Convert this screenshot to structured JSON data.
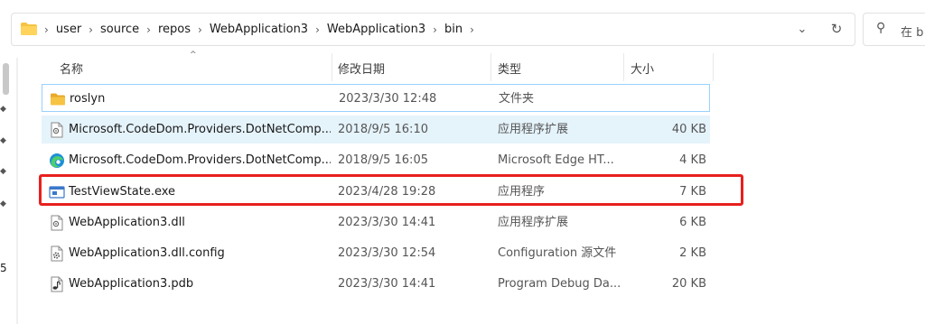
{
  "address": {
    "crumbs": [
      "user",
      "source",
      "repos",
      "WebApplication3",
      "WebApplication3",
      "bin"
    ],
    "separator": "›",
    "dropdown_glyph": "⌄",
    "refresh_glyph": "↻"
  },
  "search": {
    "placeholder": "在 b",
    "icon_glyph": "⚲"
  },
  "left_strip": {
    "number": "5"
  },
  "columns": {
    "name": "名称",
    "date": "修改日期",
    "type": "类型",
    "size": "大小"
  },
  "files": [
    {
      "name": "roslyn",
      "date": "2023/3/30 12:48",
      "type": "文件夹",
      "size": "",
      "icon": "folder-icon"
    },
    {
      "name": "Microsoft.CodeDom.Providers.DotNetComp...",
      "date": "2018/9/5 16:10",
      "type": "应用程序扩展",
      "size": "40 KB",
      "icon": "dll-icon"
    },
    {
      "name": "Microsoft.CodeDom.Providers.DotNetComp...",
      "date": "2018/9/5 16:05",
      "type": "Microsoft Edge HT...",
      "size": "4 KB",
      "icon": "edge-icon"
    },
    {
      "name": "TestViewState.exe",
      "date": "2023/4/28 19:28",
      "type": "应用程序",
      "size": "7 KB",
      "icon": "exe-icon"
    },
    {
      "name": "WebApplication3.dll",
      "date": "2023/3/30 14:41",
      "type": "应用程序扩展",
      "size": "6 KB",
      "icon": "dll-icon"
    },
    {
      "name": "WebApplication3.dll.config",
      "date": "2023/3/30 12:54",
      "type": "Configuration 源文件",
      "size": "2 KB",
      "icon": "config-icon"
    },
    {
      "name": "WebApplication3.pdb",
      "date": "2023/3/30 14:41",
      "type": "Program Debug Da...",
      "size": "20 KB",
      "icon": "pdb-icon"
    }
  ],
  "colors": {
    "selected_row": "#e5f3fb",
    "hover_border": "#99d1ff",
    "highlight_box": "#e8201d",
    "folder": "#f6c343"
  }
}
